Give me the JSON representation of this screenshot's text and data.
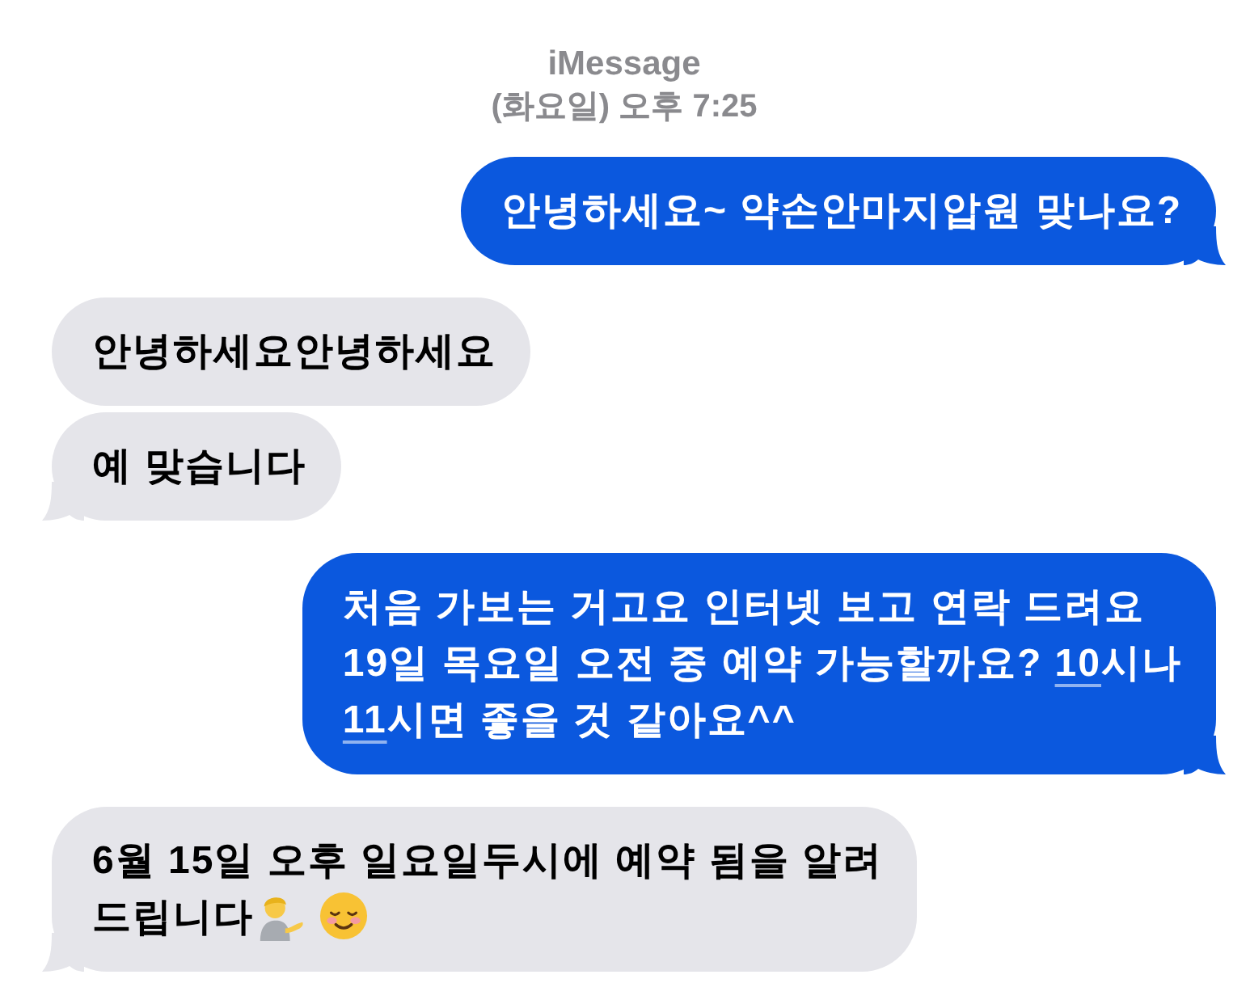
{
  "header": {
    "service": "iMessage",
    "timestamp": "(화요일) 오후 7:25"
  },
  "messages": [
    {
      "outgoing": true,
      "tail": true,
      "lines": [
        [
          {
            "kind": "text",
            "text": "안녕하세요~ 약손안마지압원 맞나요?"
          }
        ]
      ]
    },
    {
      "outgoing": false,
      "tail": false,
      "lines": [
        [
          {
            "kind": "text",
            "text": "안녕하세요안녕하세요"
          }
        ]
      ]
    },
    {
      "outgoing": false,
      "tail": true,
      "lines": [
        [
          {
            "kind": "text",
            "text": "예 맞습니다"
          }
        ]
      ]
    },
    {
      "outgoing": true,
      "tail": true,
      "lines": [
        [
          {
            "kind": "text",
            "text": "처음 가보는 거고요 인터넷 보고 연락 드려요"
          }
        ],
        [
          {
            "kind": "text",
            "text": "19일 목요일 오전 중 예약 가능할까요? "
          },
          {
            "kind": "link",
            "text": "10"
          },
          {
            "kind": "text",
            "text": "시나"
          }
        ],
        [
          {
            "kind": "link",
            "text": "11"
          },
          {
            "kind": "text",
            "text": "시면 좋을 것 같아요^^"
          }
        ]
      ]
    },
    {
      "outgoing": false,
      "tail": true,
      "lines": [
        [
          {
            "kind": "text",
            "text": "6월 15일 오후 일요일두시에 예약 됨을 알려"
          }
        ],
        [
          {
            "kind": "text",
            "text": "드립니다"
          },
          {
            "kind": "person"
          },
          {
            "kind": "smiley"
          }
        ]
      ]
    }
  ]
}
